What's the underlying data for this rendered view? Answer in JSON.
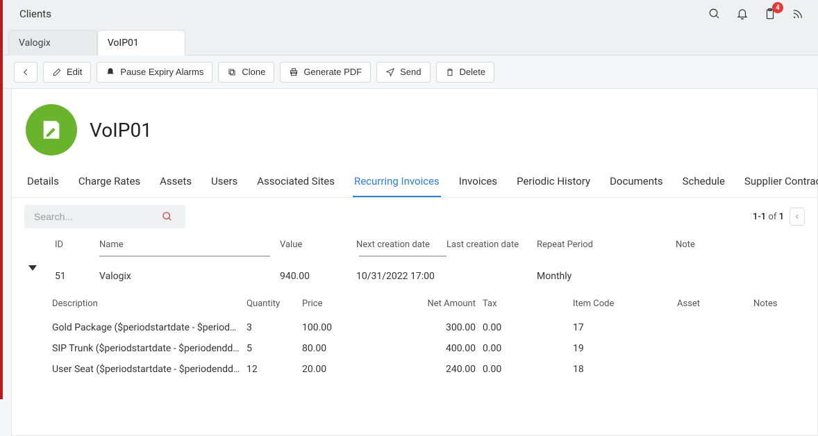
{
  "header": {
    "title": "Clients",
    "clipboard_badge": "4"
  },
  "main_tabs": [
    {
      "label": "Valogix",
      "active": false
    },
    {
      "label": "VoIP01",
      "active": true
    }
  ],
  "toolbar": {
    "edit": "Edit",
    "pause": "Pause Expiry Alarms",
    "clone": "Clone",
    "pdf": "Generate PDF",
    "send": "Send",
    "delete": "Delete"
  },
  "page": {
    "title": "VoIP01"
  },
  "sub_tabs": [
    {
      "label": "Details",
      "active": false
    },
    {
      "label": "Charge Rates",
      "active": false
    },
    {
      "label": "Assets",
      "active": false
    },
    {
      "label": "Users",
      "active": false
    },
    {
      "label": "Associated Sites",
      "active": false
    },
    {
      "label": "Recurring Invoices",
      "active": true
    },
    {
      "label": "Invoices",
      "active": false
    },
    {
      "label": "Periodic History",
      "active": false
    },
    {
      "label": "Documents",
      "active": false
    },
    {
      "label": "Schedule",
      "active": false
    },
    {
      "label": "Supplier Contracts",
      "active": false
    }
  ],
  "search": {
    "placeholder": "Search..."
  },
  "pager": {
    "range": "1-1",
    "of_word": "of",
    "total": "1"
  },
  "outer_headers": {
    "id": "ID",
    "name": "Name",
    "value": "Value",
    "next": "Next creation date",
    "last": "Last creation date",
    "repeat": "Repeat Period",
    "note": "Note"
  },
  "outer_row": {
    "id": "51",
    "name": "Valogix",
    "value": "940.00",
    "next": "10/31/2022 17:00",
    "last": "",
    "repeat": "Monthly",
    "note": ""
  },
  "detail_headers": {
    "description": "Description",
    "quantity": "Quantity",
    "price": "Price",
    "net": "Net Amount",
    "tax": "Tax",
    "item": "Item Code",
    "asset": "Asset",
    "notes": "Notes"
  },
  "detail_rows": [
    {
      "description": "Gold Package ($periodstartdate - $periodend…",
      "quantity": "3",
      "price": "100.00",
      "net": "300.00",
      "tax": "0.00",
      "item": "17",
      "asset": "",
      "notes": ""
    },
    {
      "description": "SIP Trunk ($periodstartdate - $periodenddate)",
      "quantity": "5",
      "price": "80.00",
      "net": "400.00",
      "tax": "0.00",
      "item": "19",
      "asset": "",
      "notes": ""
    },
    {
      "description": "User Seat ($periodstartdate - $periodenddate)",
      "quantity": "12",
      "price": "20.00",
      "net": "240.00",
      "tax": "0.00",
      "item": "18",
      "asset": "",
      "notes": ""
    }
  ]
}
